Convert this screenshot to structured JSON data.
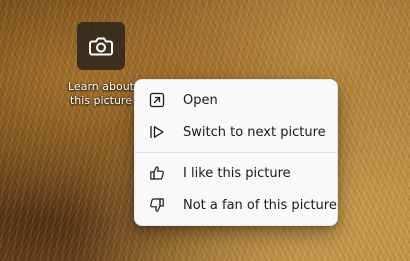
{
  "desktop": {
    "icon": {
      "name": "camera-icon",
      "label": "Learn about\nthis picture"
    }
  },
  "context_menu": {
    "items": [
      {
        "icon": "open-external-icon",
        "label": "Open"
      },
      {
        "icon": "next-picture-icon",
        "label": "Switch to next picture"
      },
      {
        "icon": "thumbs-up-icon",
        "label": "I like this picture"
      },
      {
        "icon": "thumbs-down-icon",
        "label": "Not a fan of this picture"
      }
    ]
  },
  "colors": {
    "menu_background": "#f9f9f9",
    "menu_text": "#1a1a1a",
    "icon_tile": "#2d241c"
  }
}
